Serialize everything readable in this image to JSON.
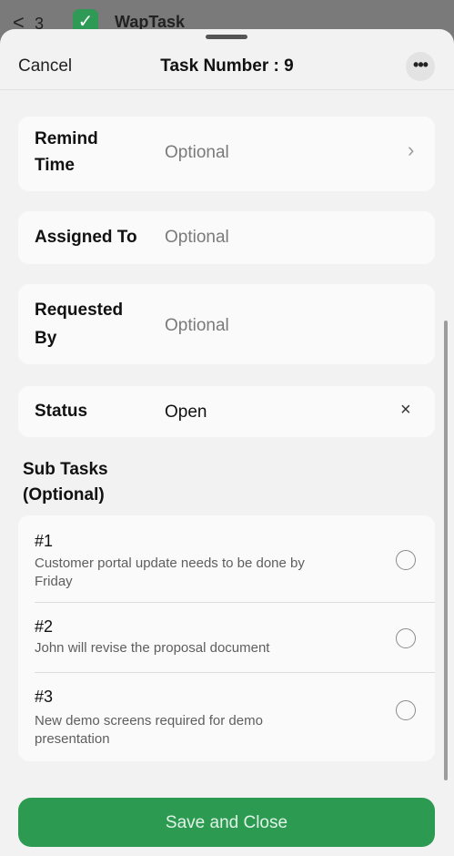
{
  "backdrop": {
    "back_glyph": "<",
    "count": "3",
    "app_name": "WapTask"
  },
  "header": {
    "cancel_label": "Cancel",
    "title": "Task Number : 9",
    "more_glyph": "•••"
  },
  "fields": {
    "remind_time": {
      "label_line1": "Remind",
      "label_line2": "Time",
      "value": "Optional",
      "chevron": "›"
    },
    "assigned_to": {
      "label": "Assigned To",
      "value": "Optional"
    },
    "requested_by": {
      "label_line1": "Requested",
      "label_line2": "By",
      "value": "Optional"
    },
    "status": {
      "label": "Status",
      "value": "Open",
      "clear": "×"
    }
  },
  "subtasks": {
    "title_line1": "Sub Tasks",
    "title_line2": "(Optional)",
    "items": [
      {
        "number": "#1",
        "text_line1": "Customer portal update needs to be done by",
        "text_line2": "Friday"
      },
      {
        "number": "#2",
        "text_line1": "John will revise the proposal document",
        "text_line2": ""
      },
      {
        "number": "#3",
        "text_line1": "New demo screens required for demo",
        "text_line2": "presentation"
      }
    ]
  },
  "footer": {
    "save_label": "Save and Close"
  },
  "colors": {
    "accent": "#2d9a52",
    "sheet_bg": "#f2f2f2",
    "card_bg": "#fafafa"
  }
}
